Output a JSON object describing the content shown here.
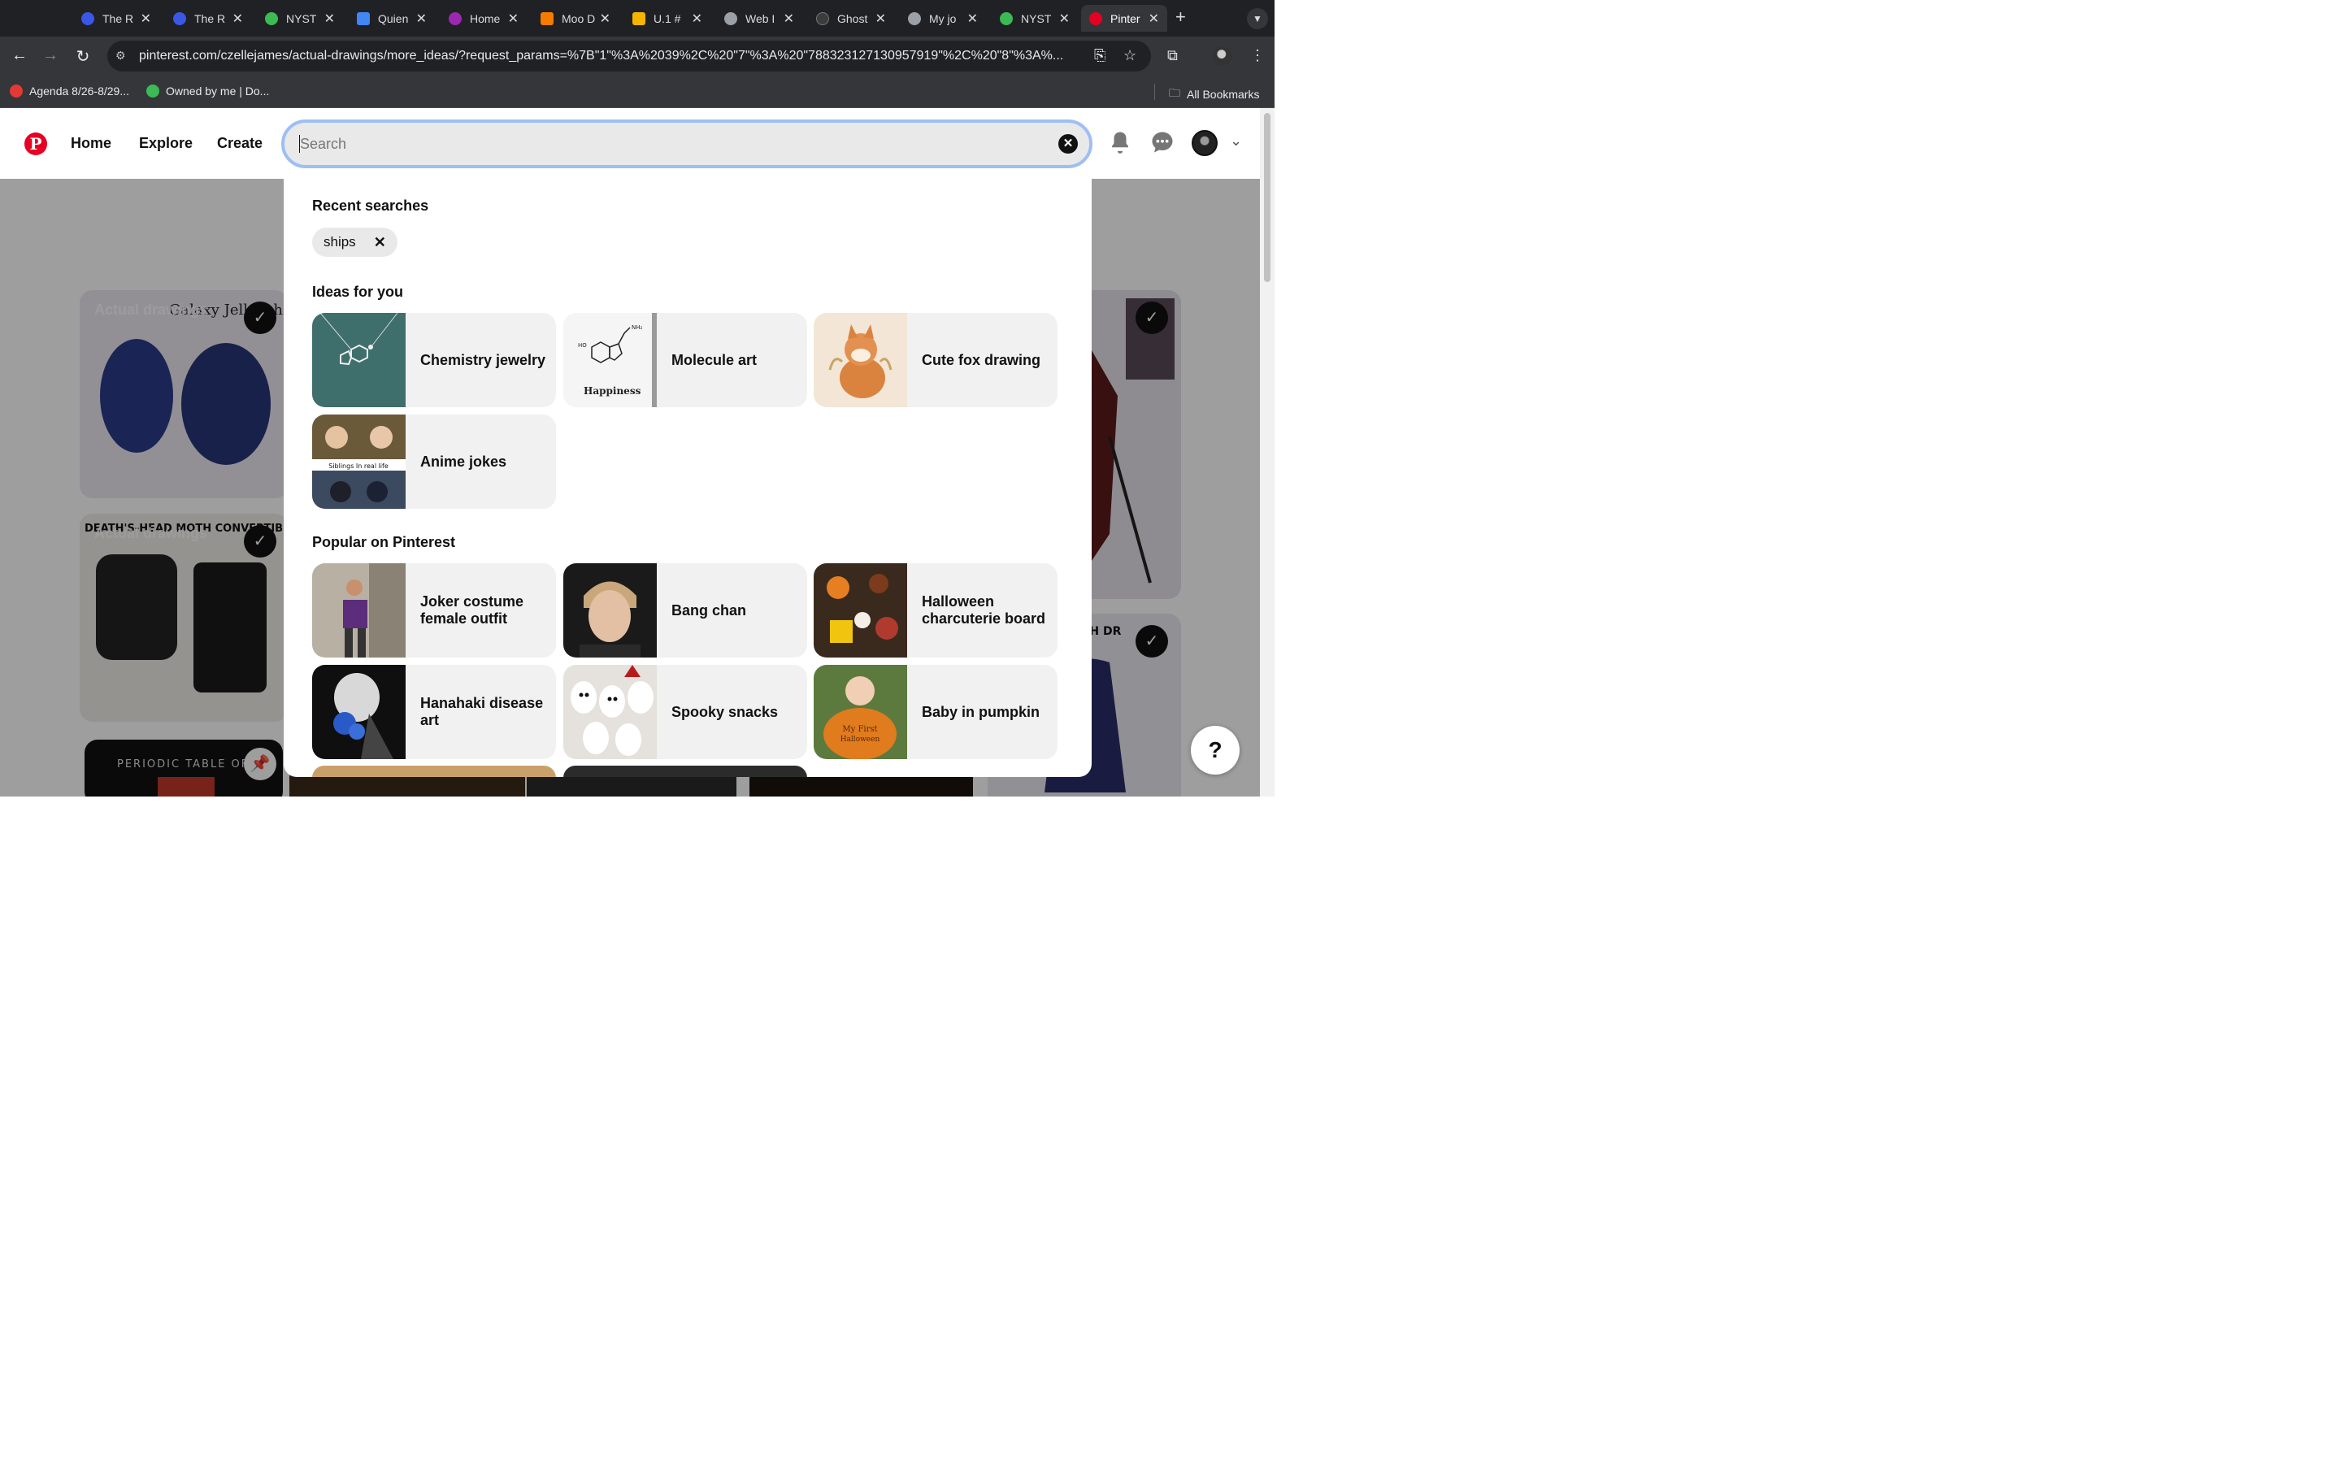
{
  "browser": {
    "tabs": [
      {
        "title": "The R",
        "color": "#3a57e8"
      },
      {
        "title": "The R",
        "color": "#3a57e8"
      },
      {
        "title": "NYST",
        "color": "#3cba54"
      },
      {
        "title": "Quien",
        "color": "#4285f4"
      },
      {
        "title": "Home",
        "color": "#9c27b0"
      },
      {
        "title": "Moo D",
        "color": "#f57c00"
      },
      {
        "title": "U.1 #",
        "color": "#f4b400"
      },
      {
        "title": "Web I",
        "color": "#9aa0a6"
      },
      {
        "title": "Ghost",
        "color": "#3c3c3c"
      },
      {
        "title": "My jo",
        "color": "#9aa0a6"
      },
      {
        "title": "NYST",
        "color": "#3cba54"
      },
      {
        "title": "Pinter",
        "color": "#e60023"
      }
    ],
    "url": "pinterest.com/czellejames/actual-drawings/more_ideas/?request_params=%7B\"1\"%3A%2039%2C%20\"7\"%3A%20\"788323127130957919\"%2C%20\"8\"%3A%...",
    "bookmarks": [
      {
        "label": "Agenda 8/26-8/29...",
        "color": "#e53935"
      },
      {
        "label": "Owned by me | Do...",
        "color": "#3cba54"
      }
    ],
    "all_bookmarks": "All Bookmarks"
  },
  "nav": {
    "logo": "P",
    "home": "Home",
    "explore": "Explore",
    "create": "Create"
  },
  "search": {
    "placeholder": "Search",
    "value": ""
  },
  "board": {
    "card_label": "Actual drawings"
  },
  "dropdown": {
    "recent_title": "Recent searches",
    "recent": [
      "ships"
    ],
    "ideas_title": "Ideas for you",
    "ideas": [
      "Chemistry jewelry",
      "Molecule art",
      "Cute fox drawing",
      "Anime jokes"
    ],
    "popular_title": "Popular on Pinterest",
    "popular": [
      "Joker costume female outfit",
      "Bang chan",
      "Halloween charcuterie board",
      "Hanahaki disease art",
      "Spooky snacks",
      "Baby in pumpkin"
    ]
  },
  "help": "?",
  "colors": {
    "pinterest_red": "#e60023",
    "search_focus_ring": "#9dbff4",
    "chrome_dark": "#35363a"
  }
}
